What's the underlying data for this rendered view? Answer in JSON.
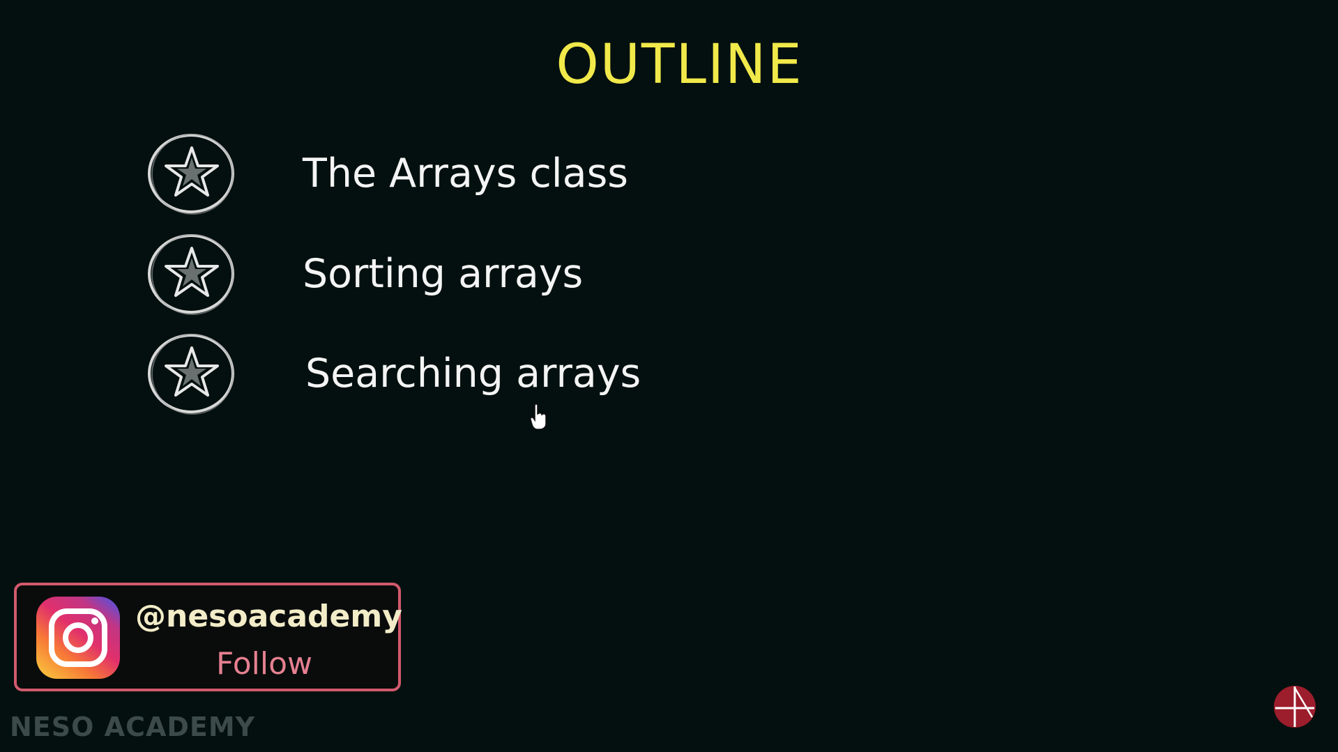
{
  "slide": {
    "title": "OUTLINE",
    "items": [
      {
        "label": "The Arrays class",
        "icon": "star-icon"
      },
      {
        "label": "Sorting arrays",
        "icon": "star-icon"
      },
      {
        "label": "Searching arrays",
        "icon": "star-icon"
      }
    ]
  },
  "promo": {
    "handle": "@nesoacademy",
    "action": "Follow",
    "icon": "instagram-icon"
  },
  "watermark": "NESO ACADEMY",
  "colors": {
    "background": "#03100f",
    "title": "#f1e94a",
    "item_text": "#f4f4f4",
    "promo_border": "#d25a6c",
    "follow": "#e58090",
    "corner_logo": "#9c1d2c"
  }
}
